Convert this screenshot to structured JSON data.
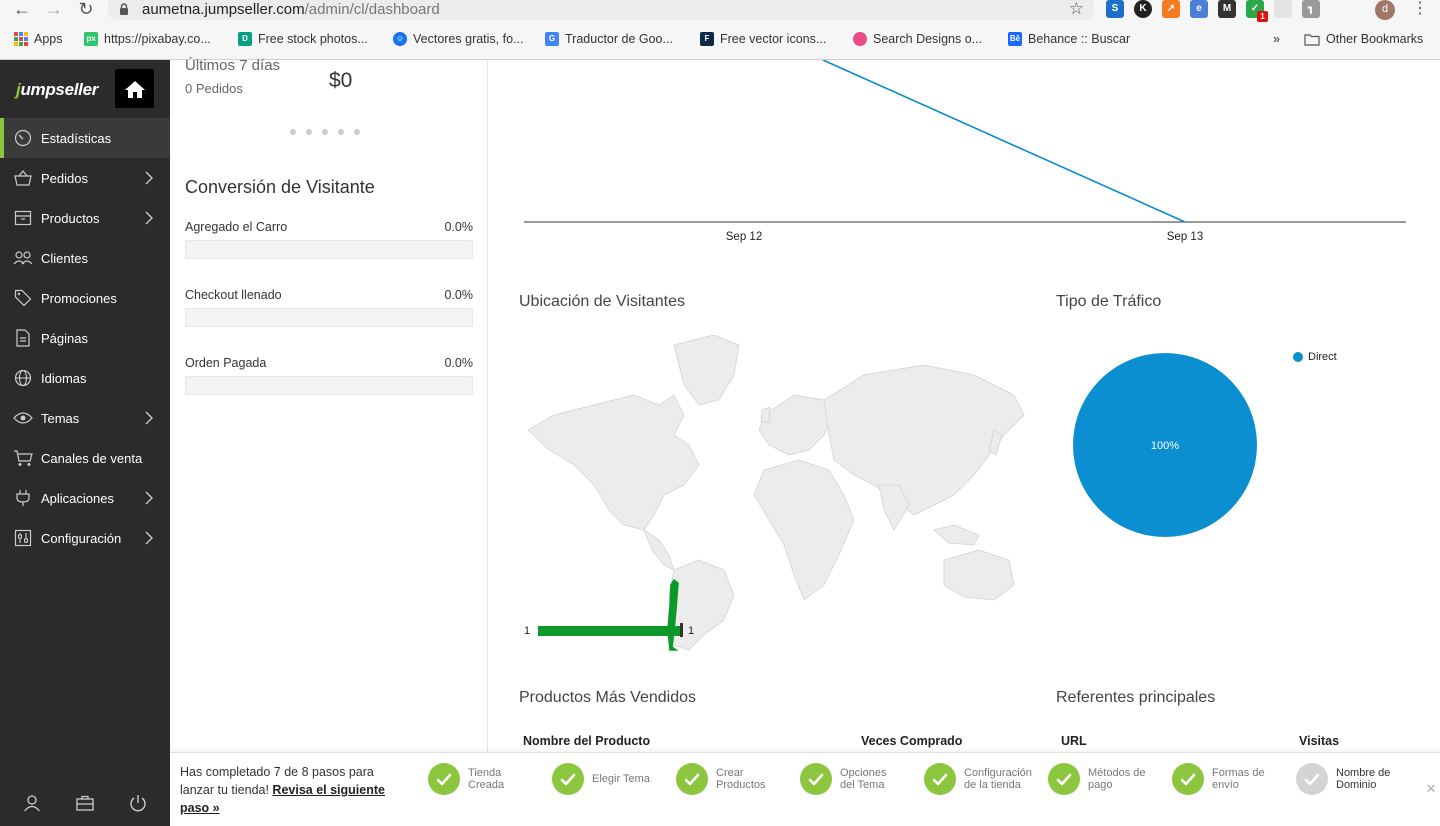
{
  "browser": {
    "url_host": "aumetna.jumpseller.com",
    "url_path": "/admin/cl/dashboard",
    "profile_initial": "d",
    "bookmarks": [
      {
        "label": "Apps",
        "icon": "apps-grid-icon"
      },
      {
        "label": "https://pixabay.co...",
        "icon": "px",
        "color": "#2ec66d"
      },
      {
        "label": "Free stock photos...",
        "icon": "D",
        "color": "#05a081"
      },
      {
        "label": "Vectores gratis, fo...",
        "icon": "freepik-icon",
        "color": "#1a73e8"
      },
      {
        "label": "Traductor de Goo...",
        "icon": "G",
        "color": "#4285f4"
      },
      {
        "label": "Free vector icons...",
        "icon": "flaticon-icon",
        "color": "#0e2a47"
      },
      {
        "label": "Search Designs o...",
        "icon": "dribbble-icon",
        "color": "#ea4c89"
      },
      {
        "label": "Behance :: Buscar",
        "icon": "Bē",
        "color": "#1769ff"
      }
    ],
    "overflow": "»",
    "other_bookmarks": "Other Bookmarks",
    "ext_badge": "1"
  },
  "sidebar": {
    "logo_prefix": "j",
    "logo_rest": "umpseller",
    "items": [
      {
        "label": "Estadísticas",
        "icon": "gauge-icon",
        "chevron": false,
        "active": true
      },
      {
        "label": "Pedidos",
        "icon": "basket-icon",
        "chevron": true
      },
      {
        "label": "Productos",
        "icon": "box-icon",
        "chevron": true
      },
      {
        "label": "Clientes",
        "icon": "users-icon",
        "chevron": false
      },
      {
        "label": "Promociones",
        "icon": "tag-icon",
        "chevron": false
      },
      {
        "label": "Páginas",
        "icon": "page-icon",
        "chevron": false
      },
      {
        "label": "Idiomas",
        "icon": "globe-icon",
        "chevron": false
      },
      {
        "label": "Temas",
        "icon": "eye-icon",
        "chevron": true
      },
      {
        "label": "Canales de venta",
        "icon": "cart-icon",
        "chevron": false
      },
      {
        "label": "Aplicaciones",
        "icon": "plug-icon",
        "chevron": true
      },
      {
        "label": "Configuración",
        "icon": "settings-icon",
        "chevron": true
      }
    ]
  },
  "summary": {
    "period": "Últimos 7 días",
    "orders": "0 Pedidos",
    "value": "$0"
  },
  "conversion": {
    "title": "Conversión de Visitante",
    "rows": [
      {
        "label": "Agregado el Carro",
        "pct": "0.0%",
        "value": 0
      },
      {
        "label": "Checkout llenado",
        "pct": "0.0%",
        "value": 0
      },
      {
        "label": "Orden Pagada",
        "pct": "0.0%",
        "value": 0
      }
    ]
  },
  "visits_chart": {
    "x_labels": [
      "Sep 12",
      "Sep 13"
    ],
    "color": "#0a8bd0"
  },
  "location": {
    "title": "Ubicación de Visitantes",
    "highlight_color": "#0b9a2a",
    "legend_min": "1",
    "legend_max": "1"
  },
  "traffic": {
    "title": "Tipo de Tráfico",
    "legend": "Direct",
    "slice_label": "100%",
    "color": "#0b8fd0"
  },
  "top_products": {
    "title": "Productos Más Vendidos",
    "col_product": "Nombre del Producto",
    "col_count": "Veces Comprado"
  },
  "referrers": {
    "title": "Referentes principales",
    "col_url": "URL",
    "col_visits": "Visitas"
  },
  "onboarding": {
    "msg": "Has completado 7 de 8 pasos para lanzar tu tienda! ",
    "link": "Revisa el siguiente paso »",
    "steps": [
      {
        "l1": "Tienda",
        "l2": "Creada",
        "done": true
      },
      {
        "l1": "Elegir Tema",
        "l2": "",
        "done": true
      },
      {
        "l1": "Crear",
        "l2": "Productos",
        "done": true
      },
      {
        "l1": "Opciones",
        "l2": "del Tema",
        "done": true
      },
      {
        "l1": "Configuración",
        "l2": "de la tienda",
        "done": true
      },
      {
        "l1": "Métodos de",
        "l2": "pago",
        "done": true
      },
      {
        "l1": "Formas de",
        "l2": "envío",
        "done": true
      },
      {
        "l1": "Nombre de",
        "l2": "Dominio",
        "done": false
      }
    ],
    "close": "×"
  },
  "chart_data": [
    {
      "type": "line",
      "title": "",
      "x": [
        "Sep 12",
        "Sep 13"
      ],
      "series": [
        {
          "name": "",
          "values": [
            null,
            0
          ]
        }
      ],
      "xlabel": "",
      "ylabel": "",
      "note_unlabeled": true
    },
    {
      "type": "pie",
      "title": "Tipo de Tráfico",
      "categories": [
        "Direct"
      ],
      "values": [
        100
      ],
      "legend": "right"
    }
  ]
}
